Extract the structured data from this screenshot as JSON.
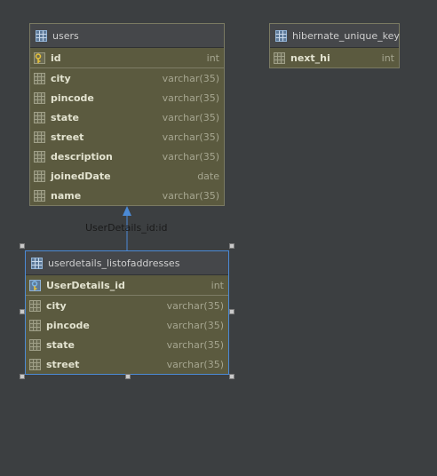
{
  "tables": {
    "users": {
      "name": "users",
      "primary_key": {
        "name": "id",
        "type": "int"
      },
      "columns": [
        {
          "name": "city",
          "type": "varchar(35)"
        },
        {
          "name": "pincode",
          "type": "varchar(35)"
        },
        {
          "name": "state",
          "type": "varchar(35)"
        },
        {
          "name": "street",
          "type": "varchar(35)"
        },
        {
          "name": "description",
          "type": "varchar(35)"
        },
        {
          "name": "joinedDate",
          "type": "date"
        },
        {
          "name": "name",
          "type": "varchar(35)"
        }
      ]
    },
    "hibernate": {
      "name": "hibernate_unique_key",
      "columns": [
        {
          "name": "next_hi",
          "type": "int"
        }
      ]
    },
    "addresses": {
      "name": "userdetails_listofaddresses",
      "primary_key": {
        "name": "UserDetails_id",
        "type": "int"
      },
      "columns": [
        {
          "name": "city",
          "type": "varchar(35)"
        },
        {
          "name": "pincode",
          "type": "varchar(35)"
        },
        {
          "name": "state",
          "type": "varchar(35)"
        },
        {
          "name": "street",
          "type": "varchar(35)"
        }
      ]
    }
  },
  "relation": {
    "label": "UserDetails_id:id",
    "color": "#4b8ad6"
  },
  "colors": {
    "background": "#3c3f41",
    "table_body": "#5b5a3f",
    "header": "#45474a",
    "selection": "#4b8ad6"
  }
}
